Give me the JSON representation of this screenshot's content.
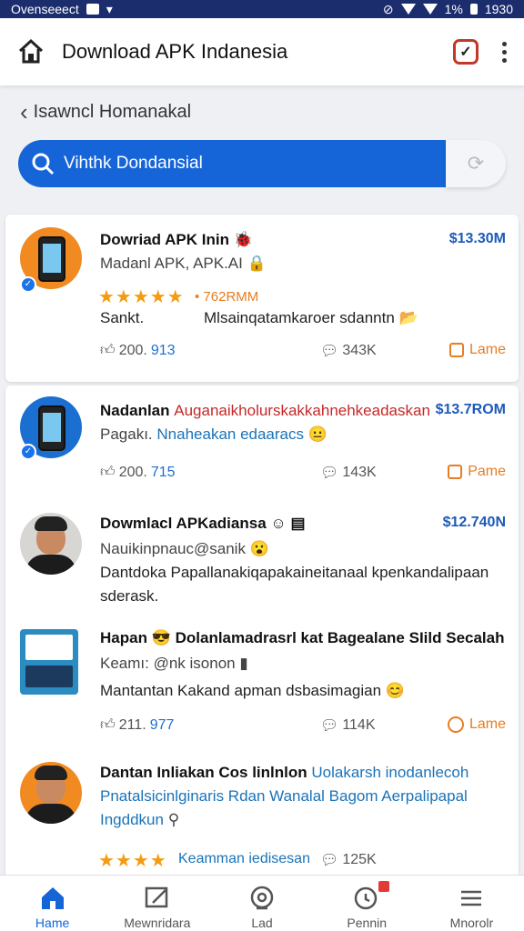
{
  "status_bar": {
    "left_text": "Ovenseeect",
    "right_battery": "1%",
    "right_time": "1930"
  },
  "app_bar": {
    "title": "Download APK Indanesia",
    "home_icon": "home-icon",
    "check_icon": "checkbox-icon",
    "more_icon": "more-vert-icon"
  },
  "breadcrumb": {
    "label": "Isawncl Homanakal"
  },
  "search": {
    "value": "Vihthk Dondansial"
  },
  "listings": [
    {
      "title": "Dowriad APK Inin",
      "subtitle": "Madanl APK, APK.AI",
      "price": "$13.30M",
      "rating": "• 762RMM",
      "desc_left": "Sankt.",
      "desc_right": "Mlsainqatamkaroer sdanntn",
      "likes": "200.",
      "likes_blue": "913",
      "comments": "343K",
      "action": "Lame"
    },
    {
      "title": "Nadanlan",
      "title_red": "Auganaikholurskakkahnehkeadaskan",
      "subtitle": "Pagakı.",
      "subtitle_blue": "Nnaheakan edaaracs",
      "price": "$13.7ROM",
      "likes": "200.",
      "likes_blue": "715",
      "comments": "143K",
      "action": "Pame"
    },
    {
      "title": "Dowmlacl APKadiansa",
      "subtitle": "Nauikinpnauc@sanik",
      "price": "$12.740N",
      "desc_line1": "Dantdoka Papallanakiqapakaineitanaal kpenkandalipaan",
      "desc_line2": "sderask."
    },
    {
      "title": "Hapan",
      "title_grey": "Dolanlamadrasrl kat Bagealane SIild Secalah",
      "subtitle": "Keamı: @nk isonon",
      "desc_line1": "Mantantan Kakand apman dsbasimagian",
      "likes": "211.",
      "likes_blue": "977",
      "comments": "114K",
      "action": "Lame"
    },
    {
      "title": "Dantan Inliakan Cos linlnlon",
      "title_blue": "Uolakarsh inodanlecoh",
      "subtitle_blue": "Pnatalsicinlginaris Rdan Wanalal Bagom Aerpalipapal",
      "subtitle_blue2": "Ingddkun",
      "rating_text": "Keamman iedisesan",
      "comments": "125K"
    }
  ],
  "bottom_nav": [
    {
      "label": "Hame",
      "icon": "home-icon"
    },
    {
      "label": "Mewnridara",
      "icon": "edit-icon"
    },
    {
      "label": "Lad",
      "icon": "headset-icon"
    },
    {
      "label": "Pennin",
      "icon": "notification-icon"
    },
    {
      "label": "Mnorolr",
      "icon": "menu-icon"
    }
  ],
  "colors": {
    "primary": "#1565d8",
    "status_bar": "#1c2d6e",
    "price": "#1e5ab8",
    "accent_orange": "#e67e22",
    "title_red": "#c62828"
  }
}
